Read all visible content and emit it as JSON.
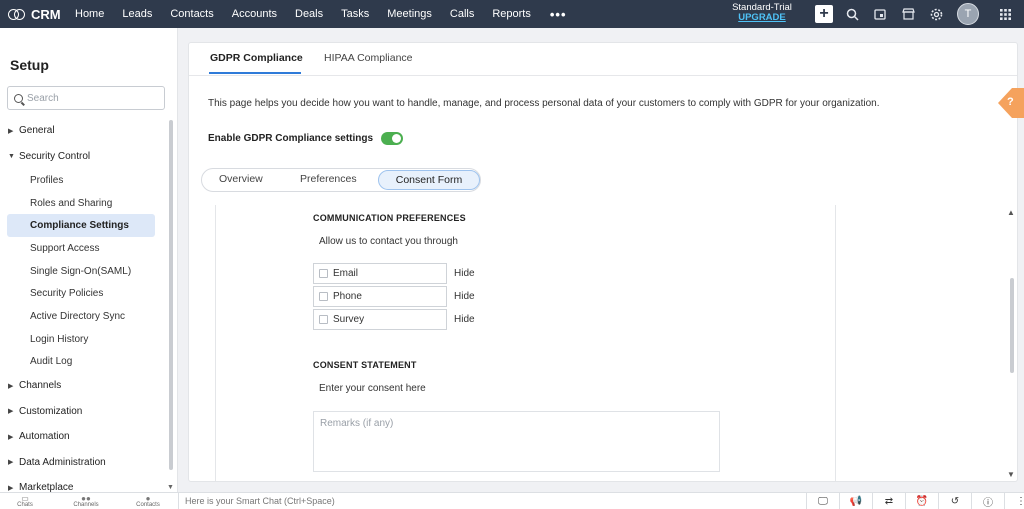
{
  "app": {
    "name": "CRM"
  },
  "nav": {
    "items": [
      "Home",
      "Leads",
      "Contacts",
      "Accounts",
      "Deals",
      "Tasks",
      "Meetings",
      "Calls",
      "Reports"
    ],
    "more": "•••"
  },
  "trial": {
    "plan": "Standard-Trial",
    "upgrade": "UPGRADE"
  },
  "user": {
    "initial": "T"
  },
  "sidebar": {
    "title": "Setup",
    "search_placeholder": "Search",
    "items": [
      {
        "label": "General",
        "type": "group",
        "expanded": false
      },
      {
        "label": "Security Control",
        "type": "group",
        "expanded": true
      },
      {
        "label": "Profiles",
        "type": "sub"
      },
      {
        "label": "Roles and Sharing",
        "type": "sub"
      },
      {
        "label": "Compliance Settings",
        "type": "sub",
        "active": true
      },
      {
        "label": "Support Access",
        "type": "sub"
      },
      {
        "label": "Single Sign-On(SAML)",
        "type": "sub"
      },
      {
        "label": "Security Policies",
        "type": "sub"
      },
      {
        "label": "Active Directory Sync",
        "type": "sub"
      },
      {
        "label": "Login History",
        "type": "sub"
      },
      {
        "label": "Audit Log",
        "type": "sub"
      },
      {
        "label": "Channels",
        "type": "group",
        "expanded": false
      },
      {
        "label": "Customization",
        "type": "group",
        "expanded": false
      },
      {
        "label": "Automation",
        "type": "group",
        "expanded": false
      },
      {
        "label": "Data Administration",
        "type": "group",
        "expanded": false
      },
      {
        "label": "Marketplace",
        "type": "group",
        "expanded": false
      }
    ]
  },
  "main": {
    "tabs": [
      "GDPR Compliance",
      "HIPAA Compliance"
    ],
    "description": "This page helps you decide how you want to handle, manage, and process personal data of your customers to comply with GDPR for your organization.",
    "enable_label": "Enable GDPR Compliance settings",
    "subtabs": [
      "Overview",
      "Preferences",
      "Consent Form"
    ],
    "communication": {
      "heading": "COMMUNICATION PREFERENCES",
      "prompt": "Allow us to contact you through",
      "options": [
        "Email",
        "Phone",
        "Survey"
      ],
      "hide_label": "Hide"
    },
    "consent": {
      "heading": "CONSENT STATEMENT",
      "prompt": "Enter your consent here",
      "remarks_placeholder": "Remarks (if any)"
    }
  },
  "bottom": {
    "left_items": [
      "Chats",
      "Channels",
      "Contacts"
    ],
    "smartchat_placeholder": "Here is your Smart Chat (Ctrl+Space)"
  },
  "colors": {
    "topbar": "#2f3a4c",
    "accent": "#2f7bd9",
    "toggle_on": "#4caf50",
    "help_tag": "#f5a25d",
    "upgrade": "#4fc3f7"
  }
}
